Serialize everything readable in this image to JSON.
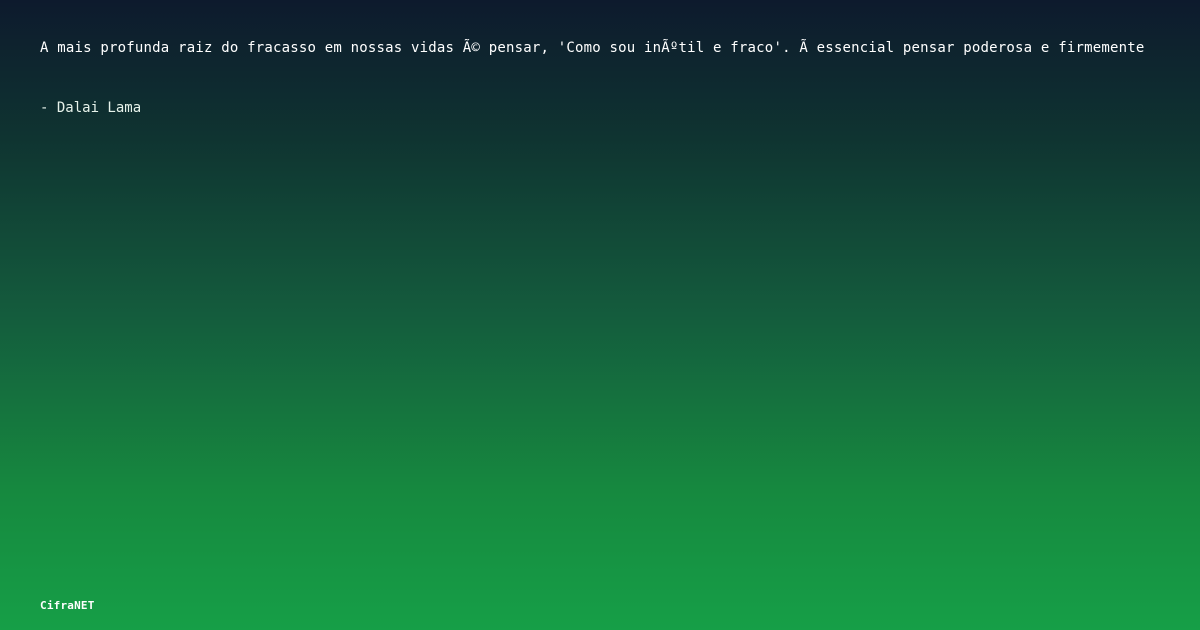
{
  "quote": {
    "text": "A mais profunda raiz do fracasso em nossas vidas Ã© pensar, 'Como sou inÃºtil e fraco'. Ã essencial pensar poderosa e firmemente",
    "author": "- Dalai Lama"
  },
  "brand": {
    "name": "CifraNET"
  }
}
